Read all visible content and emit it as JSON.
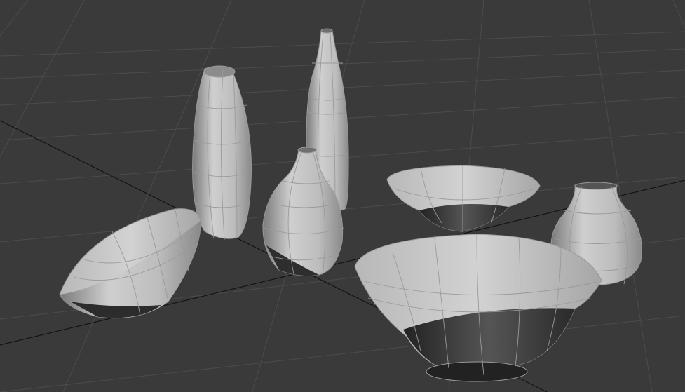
{
  "viewport": {
    "background": "#3a3a3a",
    "grid_color": "#4c4c4c",
    "axis_color": "#111111",
    "object_color": "#b4b4b4",
    "wire_color": "#9a9a9a"
  },
  "objects": [
    {
      "name": "tall-vase"
    },
    {
      "name": "bottle"
    },
    {
      "name": "small-vase"
    },
    {
      "name": "tilted-bowl"
    },
    {
      "name": "back-bowl"
    },
    {
      "name": "right-vase"
    },
    {
      "name": "large-bowl"
    }
  ]
}
